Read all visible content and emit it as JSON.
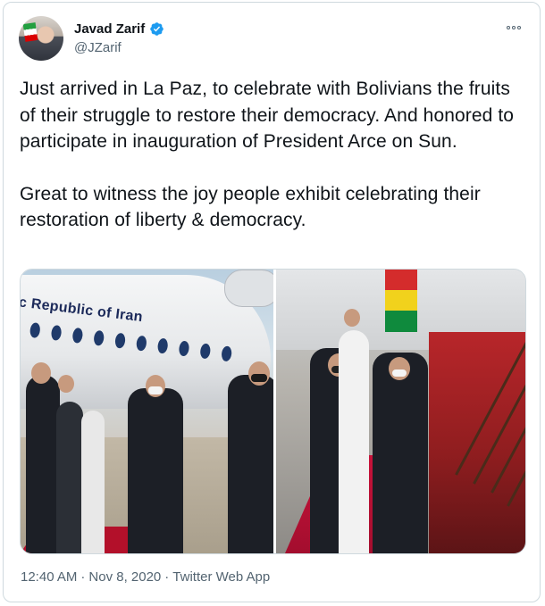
{
  "tweet": {
    "author_name": "Javad Zarif",
    "author_handle": "@JZarif",
    "verified": true,
    "paragraphs": [
      "Just arrived in La Paz, to celebrate with Bolivians the fruits of their struggle to restore their democracy. And honored to participate in inauguration of President Arce on Sun.",
      "Great to witness the joy people exhibit celebrating their restoration of liberty & democracy."
    ],
    "media": {
      "left_photo_text": "mic Republic of Iran"
    },
    "time": "12:40 AM",
    "separator": "·",
    "date": "Nov 8, 2020",
    "source": "Twitter Web App"
  },
  "icons": {
    "verified": "verified-badge-icon",
    "more": "more-options-icon"
  },
  "colors": {
    "text": "#0f1419",
    "secondary": "#536471",
    "verified_blue": "#1d9bf0",
    "border": "#cfd9de"
  }
}
